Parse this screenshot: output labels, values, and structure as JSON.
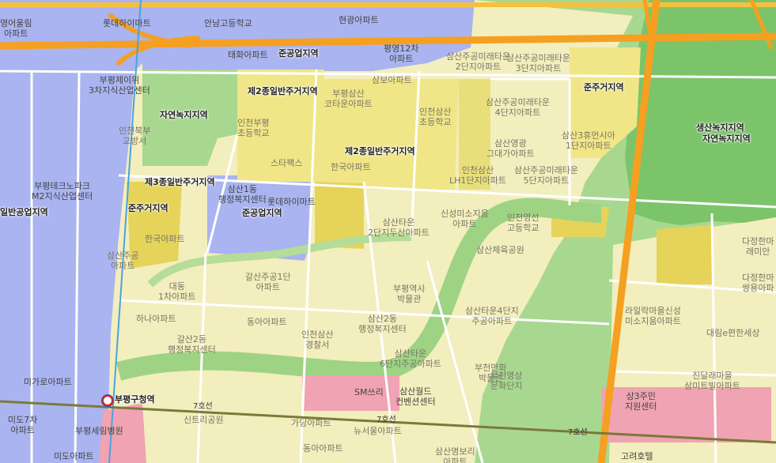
{
  "zones": {
    "semi_industrial_top": "준공업지역",
    "general2_top": "제2종일반주거지역",
    "natural_green_left": "자연녹지지역",
    "general2_mid": "제2종일반주거지역",
    "general3": "제3종일반주거지역",
    "semi_residential_left": "준주거지역",
    "semi_industrial_mid": "준공업지역",
    "general_industrial_left": "일반공업지역",
    "semi_residential_right": "준주거지역",
    "production_green": "생산녹지지역",
    "natural_green_right": "자연녹지지역"
  },
  "places": {
    "p1": "영어울림\n아파트",
    "p2": "롯데하이마트",
    "p3": "안남고등학교",
    "p4": "현광아파트",
    "p5": "태화아파트",
    "p6": "평영12차\n아파트",
    "p7": "부평제이위\n3차지식산업센터",
    "p8": "삼산주공미래타운\n2단지아파트",
    "p9": "삼산주공미래타운\n3단지아파트",
    "p10": "부평삼산\n코타운아파트",
    "p11": "삼보아파트",
    "p12": "삼산주공미래타운\n4단지아파트",
    "p13": "인천부평\n초등학교",
    "p14": "인천삼산\n초등학교",
    "p15": "삼산3휴먼시아\n1단지아파트",
    "p16": "인천북부\n교방서",
    "p17": "스타팩스",
    "p18": "한국아파트",
    "p19": "삼산영광\n그대가아파트",
    "p20": "부평테크노파크\nM2지식산업센터",
    "p21": "삼산1동\n행정복지센터",
    "p22": "인천삼산\nLH1단지아파트",
    "p23": "삼산주공미래타운\n5단지아파트",
    "p24": "롯데하이마트",
    "p25": "신성미소지움\n아파트",
    "p26": "인천영선\n고등학교",
    "p27": "한국아파트",
    "p28": "삼산타운\n2단지두산아파트",
    "p29": "삼산체육공원",
    "p30": "삼산주공\n아파트",
    "p31": "다정한마\n래미안",
    "p32": "갈산주공1단\n아파트",
    "p33": "대동\n1차아파트",
    "p34": "부평역사\n박물관",
    "p35": "다정한마\n쌍용아파",
    "p36": "하나아파트",
    "p37": "동아아파트",
    "p38": "삼산타운4단지\n주공아파트",
    "p39": "라일락마을신성\n미소지움아파트",
    "p40": "갈산2동\n행정복지센터",
    "p41": "삼산2동\n행정복지센터",
    "p42": "인천삼산\n경찰서",
    "p43": "대림e편한세상",
    "p44": "삼산타운\n6단지주공아파트",
    "p45": "미가로아파트",
    "p46": "삼산월드\n컨벤션센터",
    "p47": "부천영상\n문화단지",
    "p48": "진달래마을\n삼미트빌아파트",
    "p49": "SM쓰리",
    "p50": "미도7차\n아파트",
    "p51": "신트리공원",
    "p52": "가딩아파트",
    "p53": "뉴서울아파트",
    "p54": "상3주민\n지원센터",
    "p55": "부평세림병원",
    "p56": "동아아파트",
    "p57": "미도아파트",
    "p58": "고려호텔",
    "p59": "삼산명보리\n아파트",
    "p60": "부천만화\n박물관"
  },
  "stations": {
    "bupyeong_gu_office": "부평구청역"
  },
  "lines": {
    "line7_a": "7호선",
    "line7_b": "7호선",
    "line7_c": "7호선"
  },
  "colors": {
    "industrial": "#aab4f0",
    "general_res": "#f3eebd",
    "dense_res": "#f0e687",
    "semi_res": "#e6d35a",
    "commercial": "#f0a3b2",
    "green_light": "#a8d890",
    "green_dark": "#7cc46a",
    "highway": "#f5a020",
    "road": "#ffffff"
  }
}
